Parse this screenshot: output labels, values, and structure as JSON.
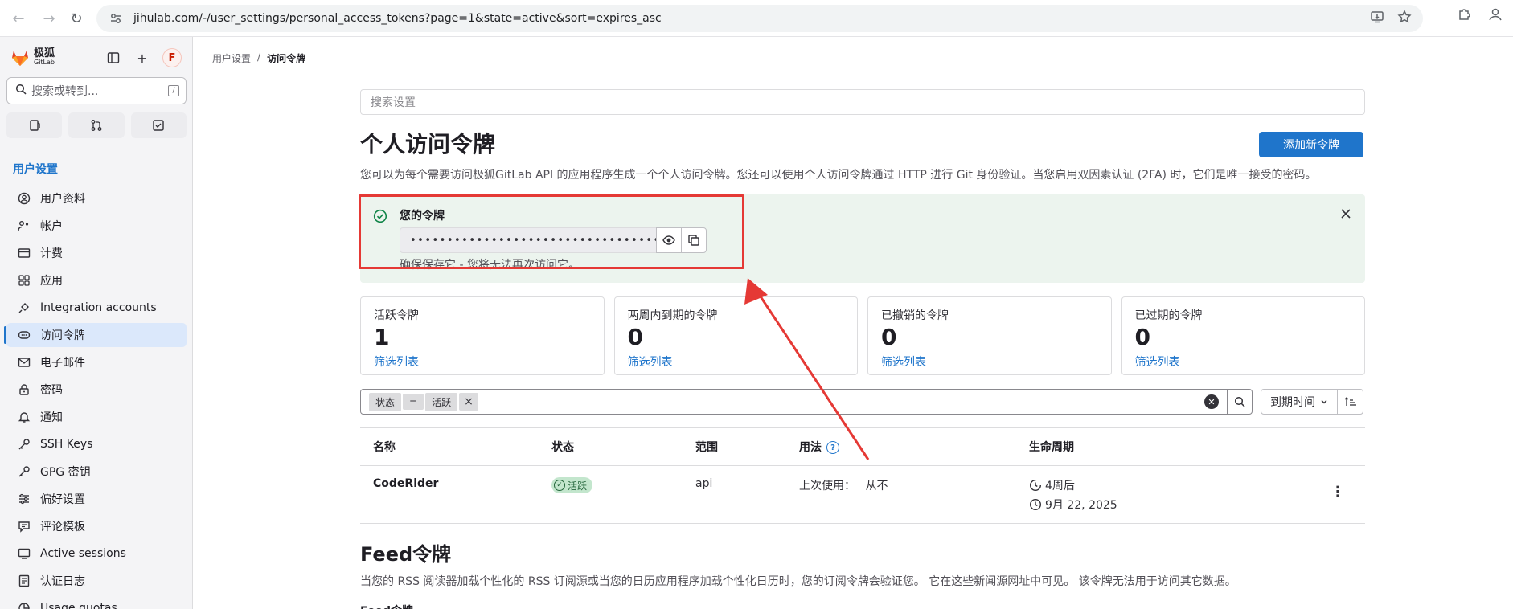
{
  "browser": {
    "url": "jihulab.com/-/user_settings/personal_access_tokens?page=1&state=active&sort=expires_asc"
  },
  "sidebar": {
    "brand_cn": "极狐",
    "brand_en": "GitLab",
    "avatar_letter": "F",
    "search_placeholder": "搜索或转到...",
    "search_kbd": "/",
    "section_title": "用户设置",
    "items": [
      {
        "label": "用户资料",
        "icon": "user-circle-icon"
      },
      {
        "label": "帐户",
        "icon": "account-gear-icon"
      },
      {
        "label": "计费",
        "icon": "card-icon"
      },
      {
        "label": "应用",
        "icon": "apps-grid-icon"
      },
      {
        "label": "Integration accounts",
        "icon": "plug-icon"
      },
      {
        "label": "访问令牌",
        "icon": "token-icon",
        "active": true
      },
      {
        "label": "电子邮件",
        "icon": "mail-icon"
      },
      {
        "label": "密码",
        "icon": "lock-icon"
      },
      {
        "label": "通知",
        "icon": "bell-icon"
      },
      {
        "label": "SSH Keys",
        "icon": "key-icon"
      },
      {
        "label": "GPG 密钥",
        "icon": "key-icon"
      },
      {
        "label": "偏好设置",
        "icon": "sliders-icon"
      },
      {
        "label": "评论模板",
        "icon": "comment-icon"
      },
      {
        "label": "Active sessions",
        "icon": "monitor-icon"
      },
      {
        "label": "认证日志",
        "icon": "log-icon"
      },
      {
        "label": "Usage quotas",
        "icon": "quota-icon"
      }
    ]
  },
  "breadcrumb": {
    "parent": "用户设置",
    "separator": "/",
    "current": "访问令牌"
  },
  "main": {
    "search_placeholder": "搜索设置",
    "title": "个人访问令牌",
    "add_button": "添加新令牌",
    "description": "您可以为每个需要访问极狐GitLab API 的应用程序生成一个个人访问令牌。您还可以使用个人访问令牌通过 HTTP 进行 Git 身份验证。当您启用双因素认证 (2FA) 时，它们是唯一接受的密码。"
  },
  "token_alert": {
    "title": "您的令牌",
    "masked_value": "••••••••••••••••••••••••••••••••••••",
    "hint": "确保保存它 - 您将无法再次访问它。"
  },
  "stats": [
    {
      "label": "活跃令牌",
      "value": "1",
      "link": "筛选列表"
    },
    {
      "label": "两周内到期的令牌",
      "value": "0",
      "link": "筛选列表"
    },
    {
      "label": "已撤销的令牌",
      "value": "0",
      "link": "筛选列表"
    },
    {
      "label": "已过期的令牌",
      "value": "0",
      "link": "筛选列表"
    }
  ],
  "filter": {
    "token_key": "状态",
    "token_op": "=",
    "token_value": "活跃",
    "sort_label": "到期时间"
  },
  "table": {
    "headers": [
      "名称",
      "状态",
      "范围",
      "用法",
      "生命周期"
    ],
    "rows": [
      {
        "name": "CodeRider",
        "status": "活跃",
        "scope": "api",
        "usage_label": "上次使用：",
        "usage_value": "从不",
        "lifetime_relative": "4周后",
        "lifetime_date": "9月 22, 2025"
      }
    ]
  },
  "feed": {
    "title": "Feed令牌",
    "description": "当您的 RSS 阅读器加载个性化的 RSS 订阅源或当您的日历应用程序加载个性化日历时，您的订阅令牌会验证您。 它在这些新闻源网址中可见。 该令牌无法用于访问其它数据。",
    "next_label": "Feed令牌"
  },
  "annotation": {
    "color": "#e53935"
  }
}
